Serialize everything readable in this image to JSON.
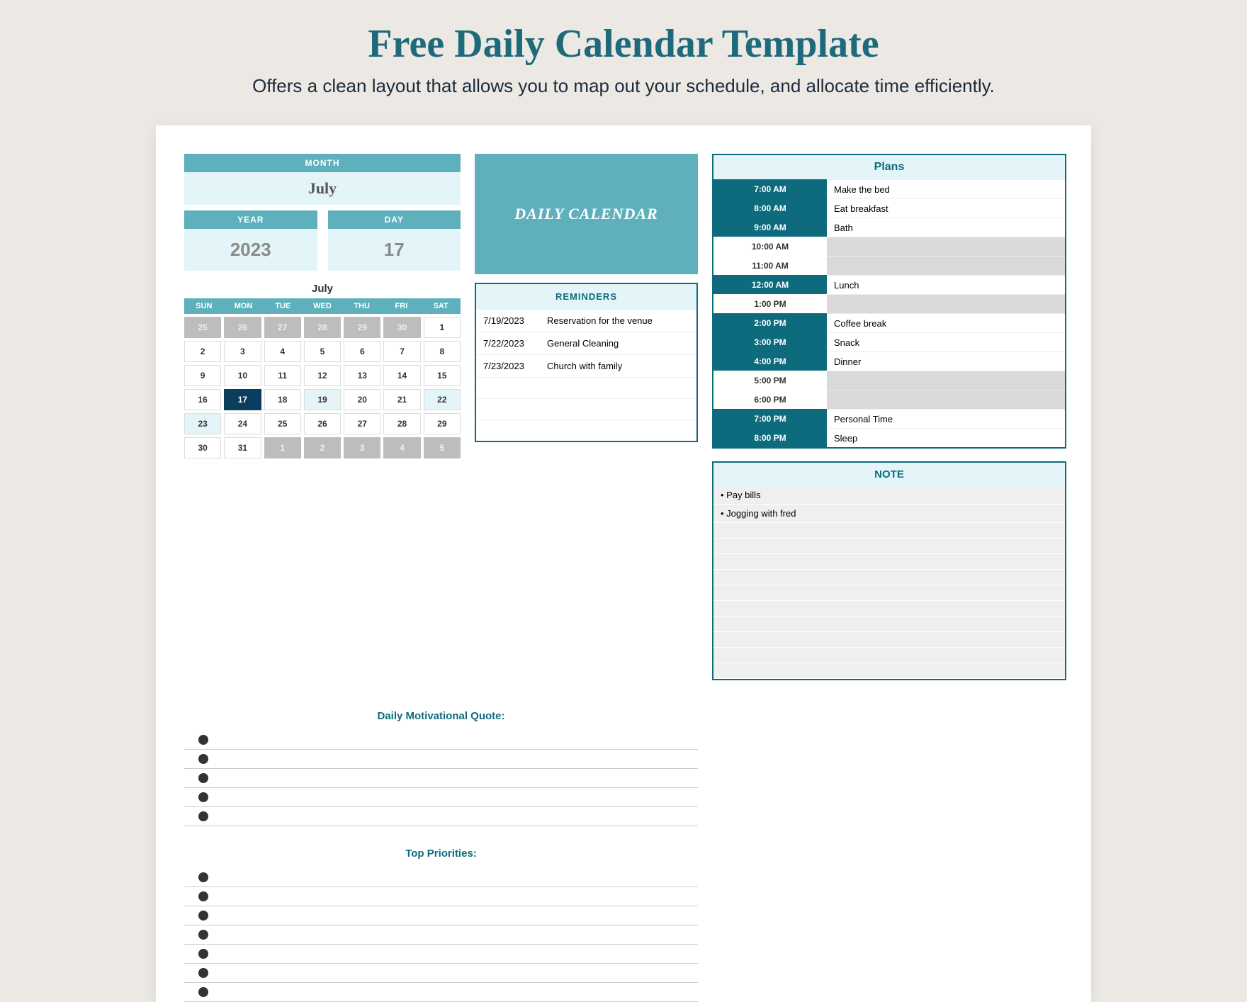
{
  "header": {
    "title": "Free Daily Calendar Template",
    "subtitle": "Offers a clean layout that allows you to map out your schedule, and allocate time efficiently."
  },
  "inputs": {
    "month_label": "MONTH",
    "month_value": "July",
    "year_label": "YEAR",
    "year_value": "2023",
    "day_label": "DAY",
    "day_value": "17"
  },
  "hero_title": "DAILY CALENDAR",
  "mini_calendar": {
    "title": "July",
    "dow": [
      "SUN",
      "MON",
      "TUE",
      "WED",
      "THU",
      "FRI",
      "SAT"
    ],
    "cells": [
      {
        "d": "25",
        "t": "other"
      },
      {
        "d": "26",
        "t": "other"
      },
      {
        "d": "27",
        "t": "other"
      },
      {
        "d": "28",
        "t": "other"
      },
      {
        "d": "29",
        "t": "other"
      },
      {
        "d": "30",
        "t": "other"
      },
      {
        "d": "1",
        "t": "cur"
      },
      {
        "d": "2",
        "t": "cur"
      },
      {
        "d": "3",
        "t": "cur"
      },
      {
        "d": "4",
        "t": "cur"
      },
      {
        "d": "5",
        "t": "cur"
      },
      {
        "d": "6",
        "t": "cur"
      },
      {
        "d": "7",
        "t": "cur"
      },
      {
        "d": "8",
        "t": "cur"
      },
      {
        "d": "9",
        "t": "cur"
      },
      {
        "d": "10",
        "t": "cur"
      },
      {
        "d": "11",
        "t": "cur"
      },
      {
        "d": "12",
        "t": "cur"
      },
      {
        "d": "13",
        "t": "cur"
      },
      {
        "d": "14",
        "t": "cur"
      },
      {
        "d": "15",
        "t": "cur"
      },
      {
        "d": "16",
        "t": "cur"
      },
      {
        "d": "17",
        "t": "sel"
      },
      {
        "d": "18",
        "t": "cur"
      },
      {
        "d": "19",
        "t": "tint"
      },
      {
        "d": "20",
        "t": "cur"
      },
      {
        "d": "21",
        "t": "cur"
      },
      {
        "d": "22",
        "t": "tint"
      },
      {
        "d": "23",
        "t": "tint"
      },
      {
        "d": "24",
        "t": "cur"
      },
      {
        "d": "25",
        "t": "cur"
      },
      {
        "d": "26",
        "t": "cur"
      },
      {
        "d": "27",
        "t": "cur"
      },
      {
        "d": "28",
        "t": "cur"
      },
      {
        "d": "29",
        "t": "cur"
      },
      {
        "d": "30",
        "t": "cur"
      },
      {
        "d": "31",
        "t": "cur"
      },
      {
        "d": "1",
        "t": "other"
      },
      {
        "d": "2",
        "t": "other"
      },
      {
        "d": "3",
        "t": "other"
      },
      {
        "d": "4",
        "t": "other"
      },
      {
        "d": "5",
        "t": "other"
      }
    ]
  },
  "reminders": {
    "title": "REMINDERS",
    "items": [
      {
        "date": "7/19/2023",
        "text": "Reservation for the venue"
      },
      {
        "date": "7/22/2023",
        "text": "General Cleaning"
      },
      {
        "date": "7/23/2023",
        "text": "Church with family"
      }
    ],
    "empty_rows": 3
  },
  "plans": {
    "title": "Plans",
    "rows": [
      {
        "time": "7:00 AM",
        "task": "Make the bed",
        "filled": true
      },
      {
        "time": "8:00 AM",
        "task": "Eat breakfast",
        "filled": true
      },
      {
        "time": "9:00 AM",
        "task": "Bath",
        "filled": true
      },
      {
        "time": "10:00 AM",
        "task": "",
        "filled": false
      },
      {
        "time": "11:00 AM",
        "task": "",
        "filled": false
      },
      {
        "time": "12:00 AM",
        "task": "Lunch",
        "filled": true
      },
      {
        "time": "1:00 PM",
        "task": "",
        "filled": false
      },
      {
        "time": "2:00 PM",
        "task": "Coffee break",
        "filled": true
      },
      {
        "time": "3:00 PM",
        "task": "Snack",
        "filled": true
      },
      {
        "time": "4:00 PM",
        "task": "Dinner",
        "filled": true
      },
      {
        "time": "5:00 PM",
        "task": "",
        "filled": false
      },
      {
        "time": "6:00 PM",
        "task": "",
        "filled": false
      },
      {
        "time": "7:00 PM",
        "task": "Personal Time",
        "filled": true
      },
      {
        "time": "8:00 PM",
        "task": "Sleep",
        "filled": true
      }
    ]
  },
  "note": {
    "title": "NOTE",
    "items": [
      "Pay bills",
      "Jogging with fred"
    ],
    "empty_rows": 10
  },
  "sections": {
    "quote_title": "Daily Motivational Quote:",
    "quote_lines": 5,
    "priorities_title": "Top Priorities:",
    "priorities_lines": 7
  }
}
